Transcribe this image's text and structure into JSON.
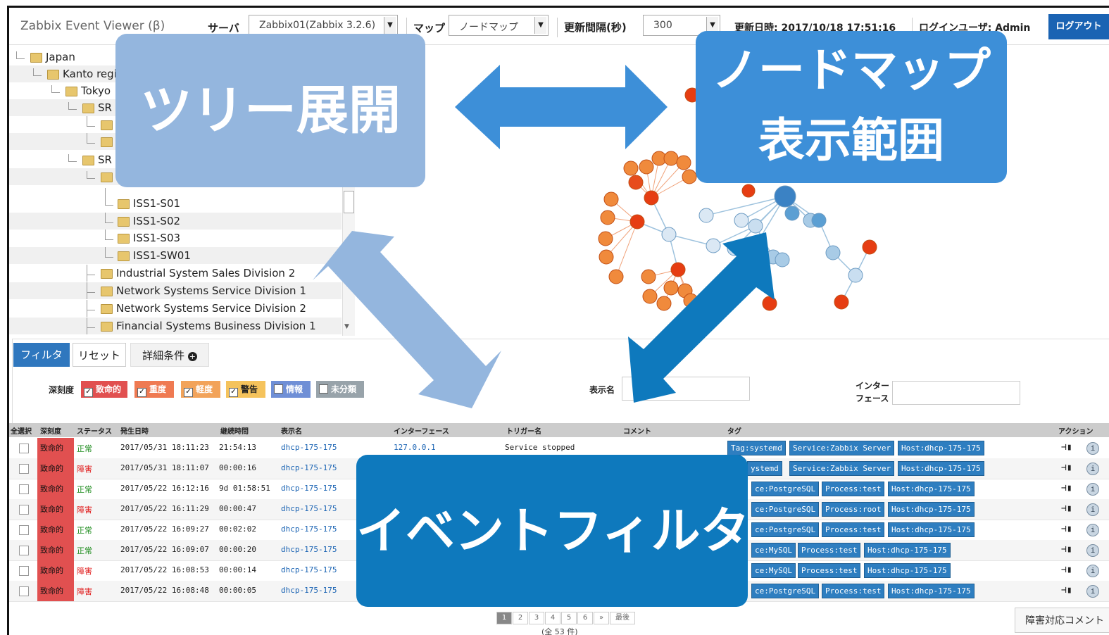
{
  "header": {
    "app_title": "Zabbix Event Viewer (β)",
    "server_label": "サーバ",
    "server_value": "Zabbix01(Zabbix 3.2.6)",
    "map_label": "マップ",
    "map_value": "ノードマップ",
    "interval_label": "更新間隔(秒)",
    "interval_value": "300",
    "updated_text": "更新日時: 2017/10/18 17:51:16",
    "login_user_text": "ログインユーザ: Admin",
    "logout_label": "ログアウト"
  },
  "tree": {
    "items": [
      {
        "label": "Japan"
      },
      {
        "label": "Kanto regi"
      },
      {
        "label": "Tokyo"
      },
      {
        "label": "SR"
      },
      {
        "label": ""
      },
      {
        "label": ""
      },
      {
        "label": "SR"
      },
      {
        "label": ""
      },
      {
        "label": "ISS1-S01"
      },
      {
        "label": "ISS1-S02"
      },
      {
        "label": "ISS1-S03"
      },
      {
        "label": "ISS1-SW01"
      },
      {
        "label": "Industrial System Sales Division 2"
      },
      {
        "label": "Network Systems Service Division 1"
      },
      {
        "label": "Network Systems Service Division 2"
      },
      {
        "label": "Financial Systems Business Division 1"
      }
    ]
  },
  "filter": {
    "filter_button": "フィルタ",
    "reset_button": "リセット",
    "advanced_button": "詳細条件",
    "severity_label": "深刻度",
    "severities": [
      {
        "label": "致命的",
        "checked": true,
        "color": "#e15050"
      },
      {
        "label": "重度",
        "checked": true,
        "color": "#ef7a52"
      },
      {
        "label": "軽度",
        "checked": true,
        "color": "#f2a35a"
      },
      {
        "label": "警告",
        "checked": true,
        "color": "#f5c35c"
      },
      {
        "label": "情報",
        "checked": false,
        "color": "#6f8fd6"
      },
      {
        "label": "未分類",
        "checked": false,
        "color": "#98a3aa"
      }
    ],
    "display_name_label": "表示名",
    "interface_label_1": "インター",
    "interface_label_2": "フェース"
  },
  "table": {
    "headers": [
      "全選択",
      "深刻度",
      "ステータス",
      "発生日時",
      "継続時間",
      "表示名",
      "インターフェース",
      "トリガー名",
      "コメント",
      "タグ",
      "アクション"
    ],
    "rows": [
      {
        "severity": "致命的",
        "status": "正常",
        "status_color": "#1a8a1a",
        "date": "2017/05/31 18:11:23",
        "duration": "21:54:13",
        "name": "dhcp-175-175",
        "iface": "127.0.0.1",
        "trigger": "Service stopped",
        "tags": [
          "Tag:systemd",
          "Service:Zabbix Server",
          "Host:dhcp-175-175"
        ]
      },
      {
        "severity": "致命的",
        "status": "障害",
        "status_color": "#e01a1a",
        "date": "2017/05/31 18:11:07",
        "duration": "00:00:16",
        "name": "dhcp-175-175",
        "iface": "",
        "trigger": "",
        "tags": [
          "ystemd",
          "Service:Zabbix Server",
          "Host:dhcp-175-175"
        ]
      },
      {
        "severity": "致命的",
        "status": "正常",
        "status_color": "#1a8a1a",
        "date": "2017/05/22 16:12:16",
        "duration": "9d 01:58:51",
        "name": "dhcp-175-175",
        "iface": "",
        "trigger": "",
        "tags": [
          "ce:PostgreSQL",
          "Process:test",
          "Host:dhcp-175-175"
        ]
      },
      {
        "severity": "致命的",
        "status": "障害",
        "status_color": "#e01a1a",
        "date": "2017/05/22 16:11:29",
        "duration": "00:00:47",
        "name": "dhcp-175-175",
        "iface": "",
        "trigger": "",
        "tags": [
          "ce:PostgreSQL",
          "Process:root",
          "Host:dhcp-175-175"
        ]
      },
      {
        "severity": "致命的",
        "status": "正常",
        "status_color": "#1a8a1a",
        "date": "2017/05/22 16:09:27",
        "duration": "00:02:02",
        "name": "dhcp-175-175",
        "iface": "",
        "trigger": "",
        "tags": [
          "ce:PostgreSQL",
          "Process:test",
          "Host:dhcp-175-175"
        ]
      },
      {
        "severity": "致命的",
        "status": "正常",
        "status_color": "#1a8a1a",
        "date": "2017/05/22 16:09:07",
        "duration": "00:00:20",
        "name": "dhcp-175-175",
        "iface": "",
        "trigger": "",
        "tags": [
          "ce:MySQL",
          "Process:test",
          "Host:dhcp-175-175"
        ]
      },
      {
        "severity": "致命的",
        "status": "障害",
        "status_color": "#e01a1a",
        "date": "2017/05/22 16:08:53",
        "duration": "00:00:14",
        "name": "dhcp-175-175",
        "iface": "",
        "trigger": "",
        "tags": [
          "ce:MySQL",
          "Process:test",
          "Host:dhcp-175-175"
        ]
      },
      {
        "severity": "致命的",
        "status": "障害",
        "status_color": "#e01a1a",
        "date": "2017/05/22 16:08:48",
        "duration": "00:00:05",
        "name": "dhcp-175-175",
        "iface": "",
        "trigger": "",
        "tags": [
          "ce:PostgreSQL",
          "Process:test",
          "Host:dhcp-175-175"
        ]
      }
    ]
  },
  "pagination": {
    "pages": [
      "1",
      "2",
      "3",
      "4",
      "5",
      "6",
      "»",
      "最後"
    ],
    "total": "(全 53 件)"
  },
  "comment_button": "障害対応コメント",
  "callouts": {
    "tree": "ツリー展開",
    "nodemap_line1": "ノードマップ",
    "nodemap_line2": "表示範囲",
    "event_filter": "イベントフィルタ"
  },
  "colors": {
    "accent": "#1a63b3",
    "callout_light": "#94b6de",
    "callout_mid": "#3d8fd8",
    "callout_dark": "#0e79bd",
    "critical": "#e15050"
  }
}
